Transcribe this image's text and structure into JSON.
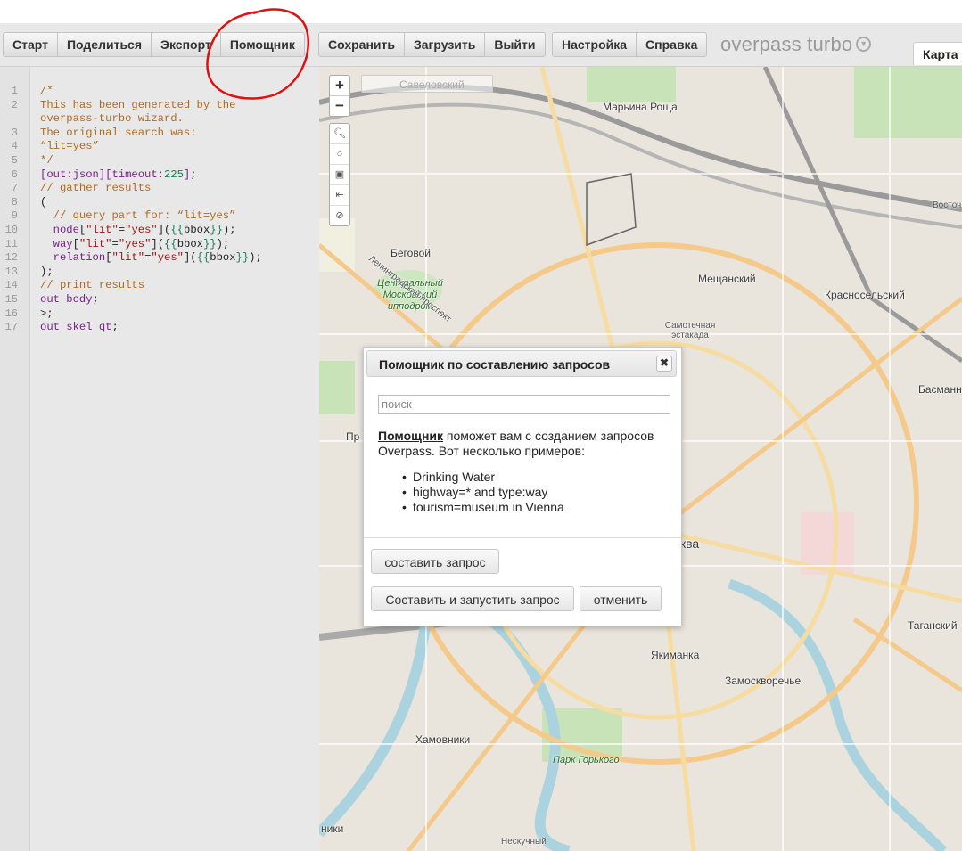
{
  "toolbar": {
    "group1": [
      "Старт",
      "Поделиться",
      "Экспорт",
      "Помощник"
    ],
    "group2": [
      "Сохранить",
      "Загрузить",
      "Выйти"
    ],
    "group3": [
      "Настройка",
      "Справка"
    ],
    "brand": "overpass turbo",
    "map_tab": "Карта"
  },
  "editor": {
    "line_numbers": [
      "1",
      "2",
      "",
      "3",
      "4",
      "5",
      "6",
      "7",
      "8",
      "9",
      "10",
      "11",
      "12",
      "13",
      "14",
      "15",
      "16",
      "17"
    ]
  },
  "map": {
    "search_placeholder": "Савеловский",
    "zoom_in": "+",
    "zoom_out": "−",
    "labels": [
      {
        "text": "Марьина Роща"
      },
      {
        "text": "Беговой"
      },
      {
        "text": "Центральный Московский ипподром"
      },
      {
        "text": "Мещанский"
      },
      {
        "text": "Самотечная эстакада"
      },
      {
        "text": "Красносельский"
      },
      {
        "text": "Басманн"
      },
      {
        "text": "Таганский"
      },
      {
        "text": "Якиманка"
      },
      {
        "text": "Замоскворечье"
      },
      {
        "text": "Хамовники"
      },
      {
        "text": "Парк Горького"
      },
      {
        "text": "Ленинградский проспект"
      },
      {
        "text": "Восточ"
      },
      {
        "text": "Пр"
      },
      {
        "text": "ква"
      },
      {
        "text": "ники"
      },
      {
        "text": "Нескучный"
      }
    ]
  },
  "dialog": {
    "title": "Помощник по составлению запросов",
    "close": "✖",
    "search_placeholder": "поиск",
    "intro_strong": "Помощник",
    "intro_rest": " поможет вам с созданием запросов Overpass. Вот несколько примеров:",
    "examples": [
      "Drinking Water",
      "highway=* and type:way",
      "tourism=museum in Vienna"
    ],
    "build_button": "составить запрос",
    "build_run_button": "Составить и запустить запрос",
    "cancel_button": "отменить"
  },
  "colors": {
    "toolbar_bg": "#e8e8e8",
    "comment": "#b06a1f",
    "keyword": "#7a1f8a",
    "string": "#a31515",
    "number": "#1a7a5a",
    "annotation": "#e01010"
  }
}
